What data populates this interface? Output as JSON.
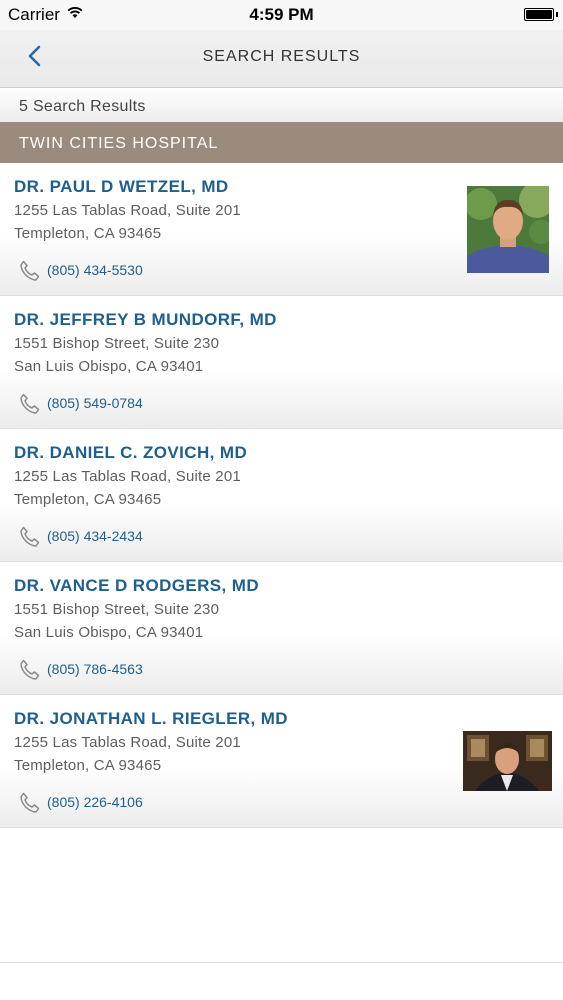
{
  "status_bar": {
    "carrier": "Carrier",
    "time": "4:59 PM"
  },
  "nav": {
    "title": "SEARCH RESULTS",
    "back_icon": "chevron-left-icon"
  },
  "results_count": "5 Search Results",
  "section": {
    "title": "TWIN CITIES HOSPITAL"
  },
  "accent_color": "#1f5f8f",
  "section_color": "#9b8b7d",
  "doctors": [
    {
      "name": "DR. PAUL D WETZEL, MD",
      "address1": "1255 Las Tablas Road, Suite 201",
      "address2": "Templeton, CA 93465",
      "phone": "(805) 434-5530",
      "has_photo": true
    },
    {
      "name": "DR. JEFFREY B MUNDORF, MD",
      "address1": "1551 Bishop Street, Suite 230",
      "address2": "San Luis Obispo, CA 93401",
      "phone": "(805) 549-0784",
      "has_photo": false
    },
    {
      "name": "DR. DANIEL C. ZOVICH, MD",
      "address1": "1255 Las Tablas Road, Suite 201",
      "address2": "Templeton, CA 93465",
      "phone": "(805) 434-2434",
      "has_photo": false
    },
    {
      "name": "DR. VANCE D RODGERS, MD",
      "address1": "1551 Bishop Street, Suite 230",
      "address2": "San Luis Obispo, CA 93401",
      "phone": "(805) 786-4563",
      "has_photo": false
    },
    {
      "name": "DR. JONATHAN L. RIEGLER, MD",
      "address1": "1255 Las Tablas Road, Suite 201",
      "address2": "Templeton, CA 93465",
      "phone": "(805) 226-4106",
      "has_photo": true
    }
  ]
}
